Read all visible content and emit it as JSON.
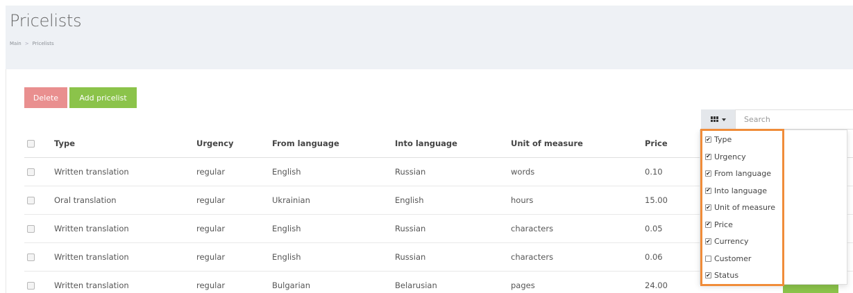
{
  "page": {
    "title": "Pricelists",
    "breadcrumb": {
      "home": "Main",
      "separator": ">",
      "current": "Pricelists"
    }
  },
  "toolbar": {
    "delete_label": "Delete",
    "add_label": "Add pricelist"
  },
  "search": {
    "placeholder": "Search"
  },
  "columns_button": {
    "icon": "columns-icon"
  },
  "table": {
    "headers": {
      "type": "Type",
      "urgency": "Urgency",
      "from": "From language",
      "into": "Into language",
      "unit": "Unit of measure",
      "price": "Price"
    },
    "rows": [
      {
        "type": "Written translation",
        "urgency": "regular",
        "from": "English",
        "into": "Russian",
        "unit": "words",
        "price": "0.10"
      },
      {
        "type": "Oral translation",
        "urgency": "regular",
        "from": "Ukrainian",
        "into": "English",
        "unit": "hours",
        "price": "15.00"
      },
      {
        "type": "Written translation",
        "urgency": "regular",
        "from": "English",
        "into": "Russian",
        "unit": "characters",
        "price": "0.05"
      },
      {
        "type": "Written translation",
        "urgency": "regular",
        "from": "English",
        "into": "Russian",
        "unit": "characters",
        "price": "0.06"
      },
      {
        "type": "Written translation",
        "urgency": "regular",
        "from": "Bulgarian",
        "into": "Belarusian",
        "unit": "pages",
        "price": "24.00"
      }
    ]
  },
  "column_menu": {
    "items": [
      {
        "label": "Type",
        "checked": true
      },
      {
        "label": "Urgency",
        "checked": true
      },
      {
        "label": "From language",
        "checked": true
      },
      {
        "label": "Into language",
        "checked": true
      },
      {
        "label": "Unit of measure",
        "checked": true
      },
      {
        "label": "Price",
        "checked": true
      },
      {
        "label": "Currency",
        "checked": true
      },
      {
        "label": "Customer",
        "checked": false
      },
      {
        "label": "Status",
        "checked": true
      }
    ]
  },
  "colors": {
    "delete": "#e98f8f",
    "add": "#8bc34a",
    "highlight": "#f08c39",
    "header_bg": "#eef1f5"
  }
}
